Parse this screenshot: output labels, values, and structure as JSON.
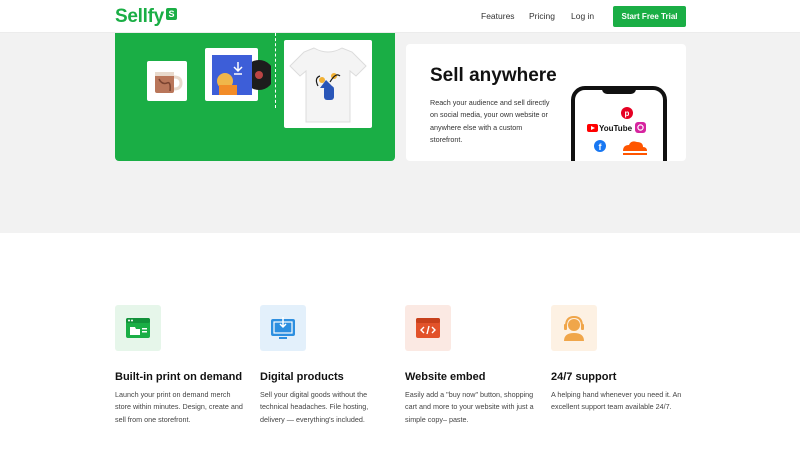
{
  "header": {
    "logo": "Sellfy",
    "logo_badge": "S",
    "nav": {
      "features": "Features",
      "pricing": "Pricing",
      "login": "Log in"
    },
    "cta": "Start Free Trial"
  },
  "sell_anywhere": {
    "title": "Sell anywhere",
    "text": "Reach your audience and sell directly on social media, your own website or anywhere else with a custom storefront.",
    "platforms": [
      "Pinterest",
      "YouTube",
      "Instagram",
      "Facebook",
      "SoundCloud"
    ]
  },
  "features": [
    {
      "title": "Built-in print on demand",
      "text": "Launch your print on demand merch store within minutes. Design, create and sell from one storefront.",
      "icon": "storefront-icon",
      "bg": "#e6f6ea",
      "color": "#1aae45"
    },
    {
      "title": "Digital products",
      "text": "Sell your digital goods without the technical headaches. File hosting, delivery — everything's included.",
      "icon": "download-screen-icon",
      "bg": "#e3f0fb",
      "color": "#2d8fe0"
    },
    {
      "title": "Website embed",
      "text": "Easily add a \"buy now\" button, shopping cart and more to your website with just a simple copy– paste.",
      "icon": "code-embed-icon",
      "bg": "#fbe9e3",
      "color": "#e2522a"
    },
    {
      "title": "24/7 support",
      "text": "A helping hand whenever you need it. An excellent support team available 24/7.",
      "icon": "headset-support-icon",
      "bg": "#fdf1e3",
      "color": "#f0a64a"
    }
  ],
  "colors": {
    "brand": "#1aae45",
    "band": "#f2f2f2"
  }
}
